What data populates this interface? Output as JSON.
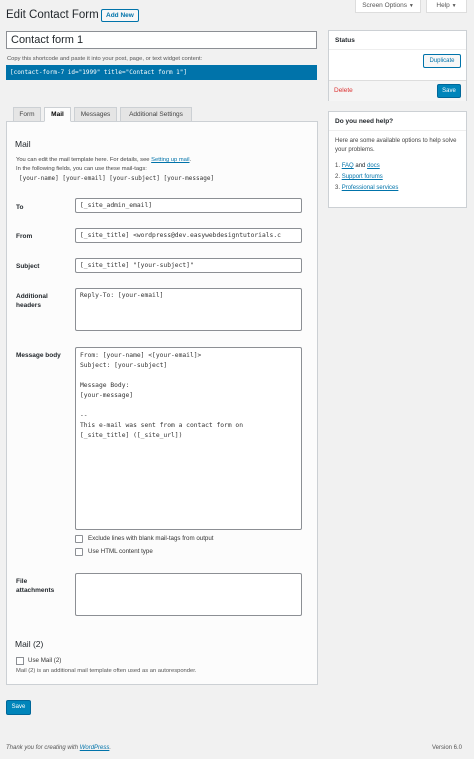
{
  "header": {
    "title": "Edit Contact Form",
    "add_new": "Add New",
    "screen_options": "Screen Options",
    "help": "Help"
  },
  "form_title": "Contact form 1",
  "shortcode": {
    "hint": "Copy this shortcode and paste it into your post, page, or text widget content:",
    "value": "[contact-form-7 id=\"1999\" title=\"Contact form 1\"]"
  },
  "status_box": {
    "title": "Status",
    "duplicate": "Duplicate",
    "delete": "Delete",
    "save": "Save"
  },
  "help_box": {
    "title": "Do you need help?",
    "text": "Here are some available options to help solve your problems.",
    "items": [
      {
        "num": "1.",
        "a": "FAQ",
        "and": "and",
        "b": "docs"
      },
      {
        "num": "2.",
        "a": "Support forums"
      },
      {
        "num": "3.",
        "a": "Professional services"
      }
    ]
  },
  "tabs": [
    "Form",
    "Mail",
    "Messages",
    "Additional Settings"
  ],
  "mail": {
    "heading": "Mail",
    "desc_1": "You can edit the mail template here. For details, see",
    "desc_link": "Setting up mail",
    "desc_2": "In the following fields, you can use these mail-tags:",
    "tags": "[your-name] [your-email] [your-subject] [your-message]",
    "to_label": "To",
    "to_value": "[_site_admin_email]",
    "from_label": "From",
    "from_value": "[_site_title] <wordpress@dev.easywebdesigntutorials.c",
    "subject_label": "Subject",
    "subject_value": "[_site_title] \"[your-subject]\"",
    "headers_label_1": "Additional",
    "headers_label_2": "headers",
    "headers_value": "Reply-To: [your-email]",
    "body_label": "Message body",
    "body_value": "From: [your-name] <[your-email]>\nSubject: [your-subject]\n\nMessage Body:\n[your-message]\n\n--\nThis e-mail was sent from a contact form on\n[_site_title] ([_site_url])",
    "exclude_label": "Exclude lines with blank mail-tags from output",
    "html_label": "Use HTML content type",
    "attach_label_1": "File",
    "attach_label_2": "attachments",
    "attach_value": ""
  },
  "mail2": {
    "heading": "Mail (2)",
    "checkbox_label": "Use Mail (2)",
    "desc": "Mail (2) is an additional mail template often used as an autoresponder."
  },
  "save": "Save",
  "footer": {
    "thanks": "Thank you for creating with",
    "wp_link": "WordPress",
    "version": "Version 6.0"
  }
}
